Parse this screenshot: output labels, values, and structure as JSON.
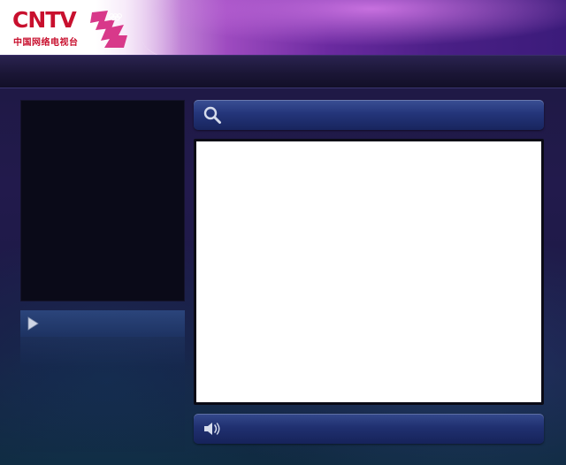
{
  "brand": {
    "logo_text": "CNTV",
    "logo_subtitle": "中国网络电视台",
    "emblem_icon": "london-2012-emblem-icon",
    "brand_color": "#c8102e",
    "emblem_color": "#d8398a"
  },
  "search": {
    "icon": "search-icon",
    "placeholder": "",
    "value": ""
  },
  "player": {
    "screen_color": "#ffffff"
  },
  "side_panel": {
    "play_icon": "play-icon"
  },
  "controls": {
    "volume_icon": "speaker-icon"
  },
  "colors": {
    "background": "#1e1a46",
    "bar_blue": "#24357a"
  }
}
